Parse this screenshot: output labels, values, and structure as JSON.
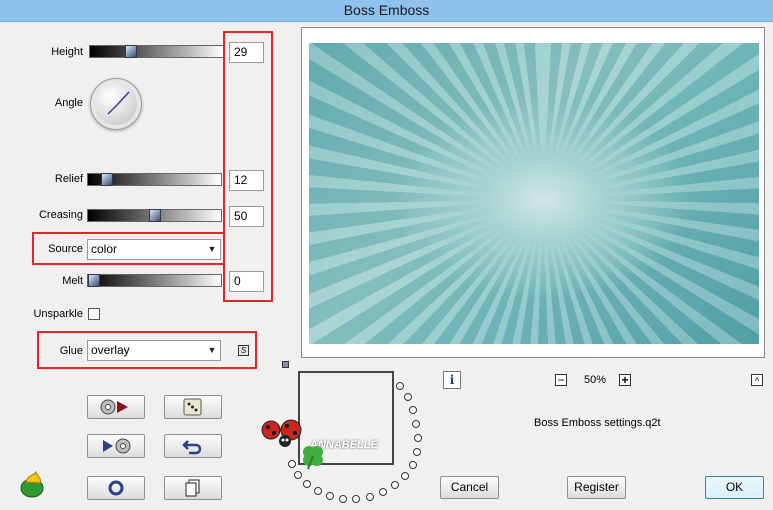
{
  "window": {
    "title": "Boss Emboss"
  },
  "controls": {
    "height": {
      "label": "Height",
      "value": "29",
      "fraction": 0.29
    },
    "angle": {
      "label": "Angle"
    },
    "relief": {
      "label": "Relief",
      "value": "12",
      "fraction": 0.12
    },
    "creasing": {
      "label": "Creasing",
      "value": "50",
      "fraction": 0.5
    },
    "source": {
      "label": "Source",
      "selected": "color"
    },
    "melt": {
      "label": "Melt",
      "value": "0",
      "fraction": 0.0
    },
    "unsparkle": {
      "label": "Unsparkle",
      "checked": false
    },
    "glue": {
      "label": "Glue",
      "selected": "overlay"
    }
  },
  "zoom": {
    "minus": "−",
    "value": "50%",
    "plus": "+"
  },
  "settings_file": "Boss Emboss settings.q2t",
  "buttons": {
    "cancel": "Cancel",
    "register": "Register",
    "ok": "OK",
    "info": "i",
    "link": "S",
    "expand": "^"
  },
  "watermark": "ANNABELLE",
  "colors": {
    "title_bar": "#8ec1ee",
    "highlight": "#e3262a",
    "background": "#f0f0f0"
  },
  "icons": {
    "preset_load": "film-play-icon",
    "random": "dice-icon",
    "play_to_file": "play-film-icon",
    "undo": "undo-arrow-icon",
    "reset": "ring-icon",
    "copy": "copy-pages-icon",
    "logo": "flaming-pear-logo-icon"
  }
}
